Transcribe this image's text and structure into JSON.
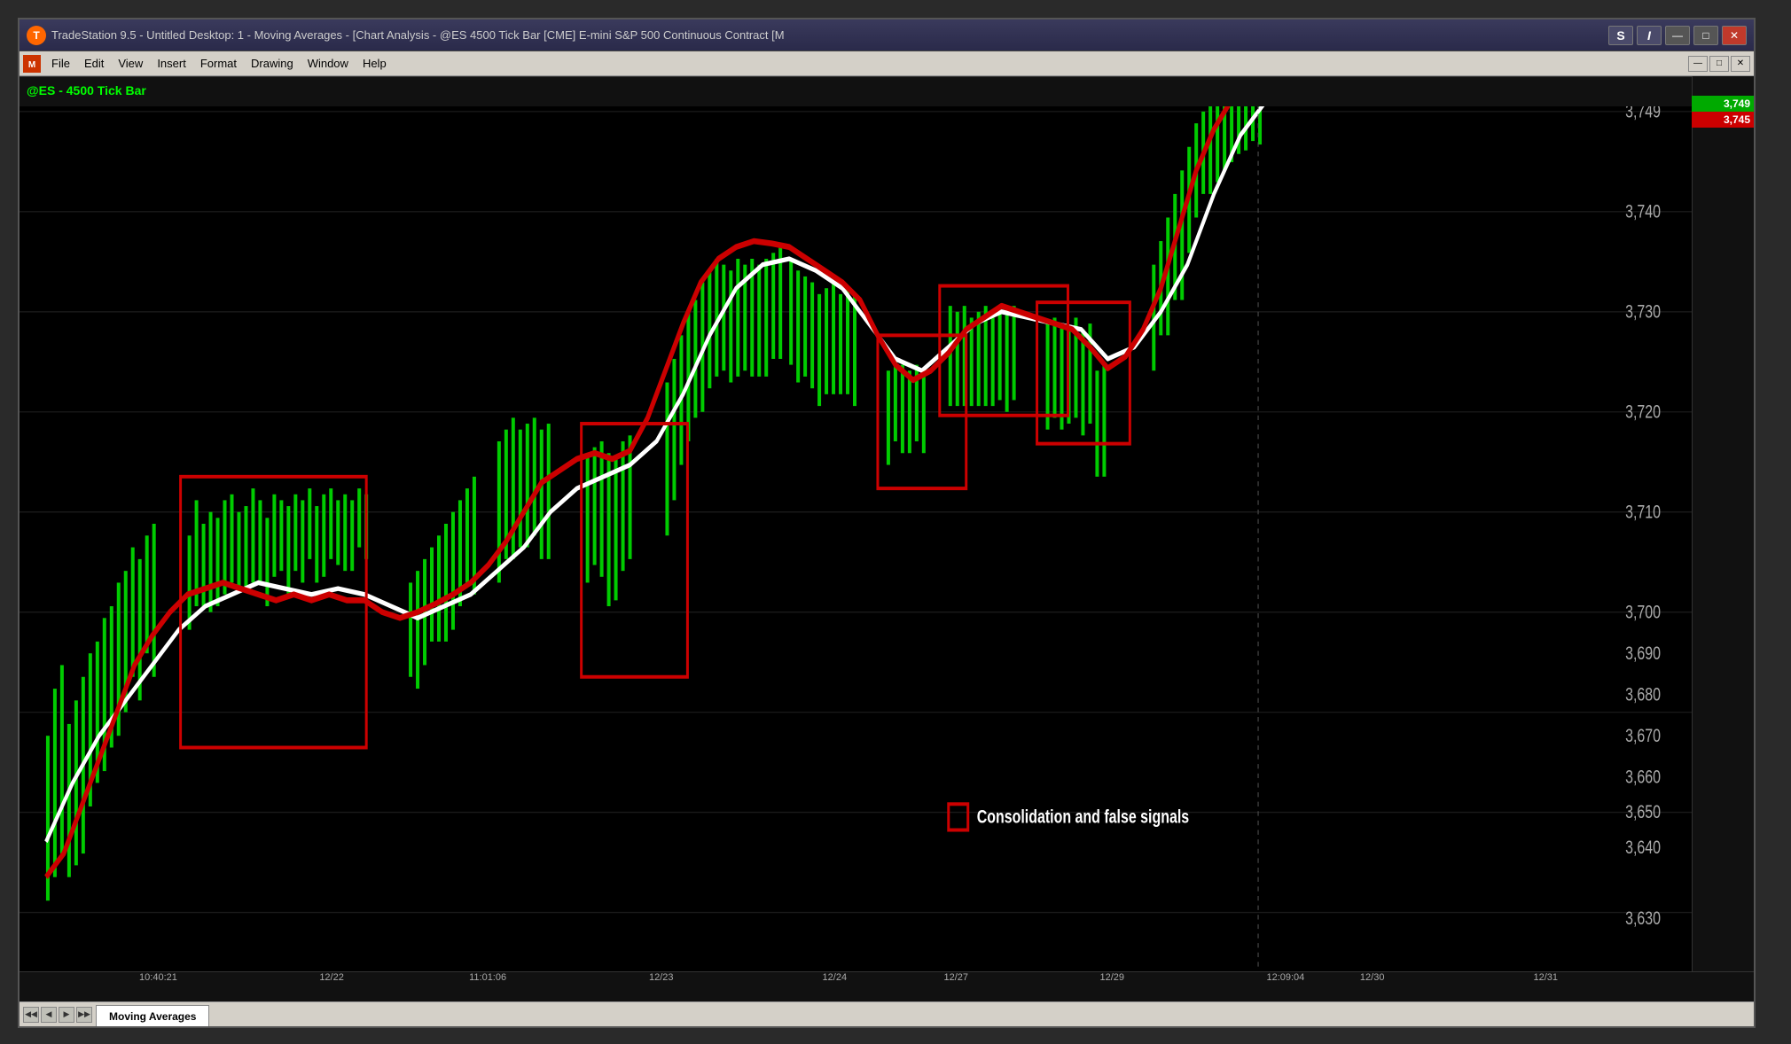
{
  "title": {
    "text": "TradeStation 9.5 - Untitled Desktop: 1 - Moving Averages - [Chart Analysis - @ES 4500 Tick Bar [CME] E-mini S&P 500 Continuous Contract [M",
    "s_btn": "S",
    "i_btn": "I",
    "min": "—",
    "max": "□",
    "close": "✕"
  },
  "menu": {
    "icon_text": "M",
    "items": [
      "File",
      "Edit",
      "View",
      "Insert",
      "Format",
      "Drawing",
      "Window",
      "Help"
    ],
    "inner_btns": [
      "—",
      "□",
      "✕"
    ]
  },
  "chart": {
    "label": "@ES - 4500 Tick Bar",
    "prices": [
      {
        "label": "3,749",
        "y_pct": 4
      },
      {
        "label": "3,740",
        "y_pct": 15
      },
      {
        "label": "3,730",
        "y_pct": 27
      },
      {
        "label": "3,720",
        "y_pct": 39
      },
      {
        "label": "3,710",
        "y_pct": 51
      },
      {
        "label": "3,700",
        "y_pct": 63
      },
      {
        "label": "3,690",
        "y_pct": 68
      },
      {
        "label": "3,680",
        "y_pct": 74
      },
      {
        "label": "3,670",
        "y_pct": 80
      },
      {
        "label": "3,660",
        "y_pct": 83
      },
      {
        "label": "3,650",
        "y_pct": 86
      },
      {
        "label": "3,640",
        "y_pct": 90
      },
      {
        "label": "3,630",
        "y_pct": 96
      }
    ],
    "current_high": "3,749",
    "current_low": "3,745"
  },
  "time_labels": [
    {
      "label": "10:40:21",
      "pct": 8
    },
    {
      "label": "12/22",
      "pct": 18
    },
    {
      "label": "11:01:06",
      "pct": 27
    },
    {
      "label": "12/23",
      "pct": 37
    },
    {
      "label": "12/24",
      "pct": 47
    },
    {
      "label": "12/27",
      "pct": 54
    },
    {
      "label": "12/29",
      "pct": 63
    },
    {
      "label": "12:09:04",
      "pct": 73
    },
    {
      "label": "12/30",
      "pct": 78
    },
    {
      "label": "12/31",
      "pct": 88
    }
  ],
  "legend": {
    "text": "Consolidation and false signals"
  },
  "tab": {
    "label": "Moving Averages"
  },
  "nav_btns": [
    "◀◀",
    "◀",
    "▶",
    "▶▶"
  ]
}
